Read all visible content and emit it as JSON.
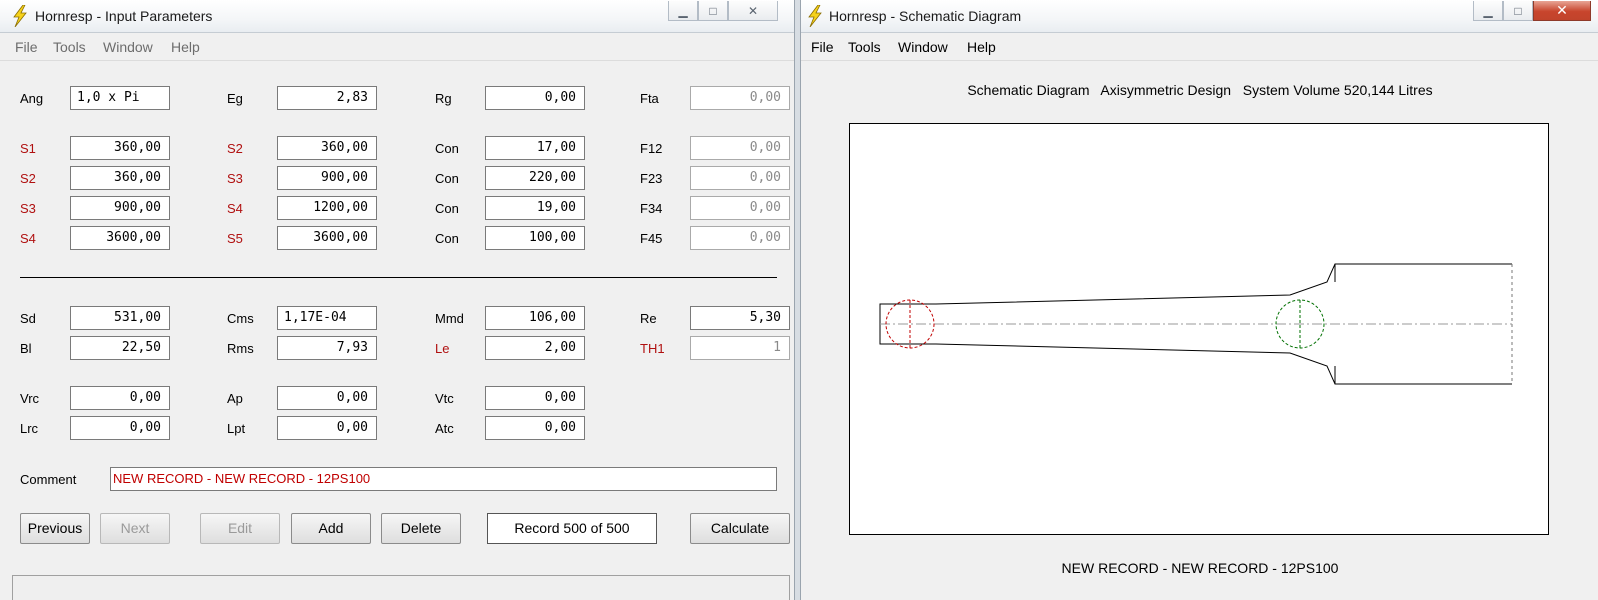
{
  "input_window": {
    "title": "Hornresp - Input Parameters",
    "menu": [
      "File",
      "Tools",
      "Window",
      "Help"
    ],
    "row_top": {
      "ang": {
        "label": "Ang",
        "value": "1,0 x Pi"
      },
      "eg": {
        "label": "Eg",
        "value": "2,83"
      },
      "rg": {
        "label": "Rg",
        "value": "0,00"
      },
      "fta": {
        "label": "Fta",
        "value": "0,00"
      }
    },
    "segments": [
      {
        "sa": "S1",
        "sa_val": "360,00",
        "sb": "S2",
        "sb_val": "360,00",
        "con": "Con",
        "con_val": "17,00",
        "f": "F12",
        "f_val": "0,00"
      },
      {
        "sa": "S2",
        "sa_val": "360,00",
        "sb": "S3",
        "sb_val": "900,00",
        "con": "Con",
        "con_val": "220,00",
        "f": "F23",
        "f_val": "0,00"
      },
      {
        "sa": "S3",
        "sa_val": "900,00",
        "sb": "S4",
        "sb_val": "1200,00",
        "con": "Con",
        "con_val": "19,00",
        "f": "F34",
        "f_val": "0,00"
      },
      {
        "sa": "S4",
        "sa_val": "3600,00",
        "sb": "S5",
        "sb_val": "3600,00",
        "con": "Con",
        "con_val": "100,00",
        "f": "F45",
        "f_val": "0,00"
      }
    ],
    "driver": {
      "sd": {
        "label": "Sd",
        "value": "531,00"
      },
      "cms": {
        "label": "Cms",
        "value": "1,17E-04"
      },
      "mmd": {
        "label": "Mmd",
        "value": "106,00"
      },
      "re": {
        "label": "Re",
        "value": "5,30"
      },
      "bl": {
        "label": "Bl",
        "value": "22,50"
      },
      "rms": {
        "label": "Rms",
        "value": "7,93"
      },
      "le": {
        "label": "Le",
        "value": "2,00"
      },
      "th1": {
        "label": "TH1",
        "value": "1"
      }
    },
    "chamber": {
      "vrc": {
        "label": "Vrc",
        "value": "0,00"
      },
      "ap": {
        "label": "Ap",
        "value": "0,00"
      },
      "vtc": {
        "label": "Vtc",
        "value": "0,00"
      },
      "lrc": {
        "label": "Lrc",
        "value": "0,00"
      },
      "lpt": {
        "label": "Lpt",
        "value": "0,00"
      },
      "atc": {
        "label": "Atc",
        "value": "0,00"
      }
    },
    "comment": {
      "label": "Comment",
      "value": "NEW RECORD - NEW RECORD - 12PS100"
    },
    "buttons": {
      "previous": "Previous",
      "next": "Next",
      "edit": "Edit",
      "add": "Add",
      "delete": "Delete",
      "calculate": "Calculate"
    },
    "record_status": "Record 500 of 500"
  },
  "schematic_window": {
    "title": "Hornresp - Schematic Diagram",
    "menu": [
      "File",
      "Tools",
      "Window",
      "Help"
    ],
    "heading": "Schematic Diagram   Axisymmetric Design   System Volume 520,144 Litres",
    "footer": "NEW RECORD - NEW RECORD - 12PS100"
  },
  "colors": {
    "red_label": "#b01010",
    "driver_circle_1": "#c00000",
    "driver_circle_2": "#007000"
  }
}
